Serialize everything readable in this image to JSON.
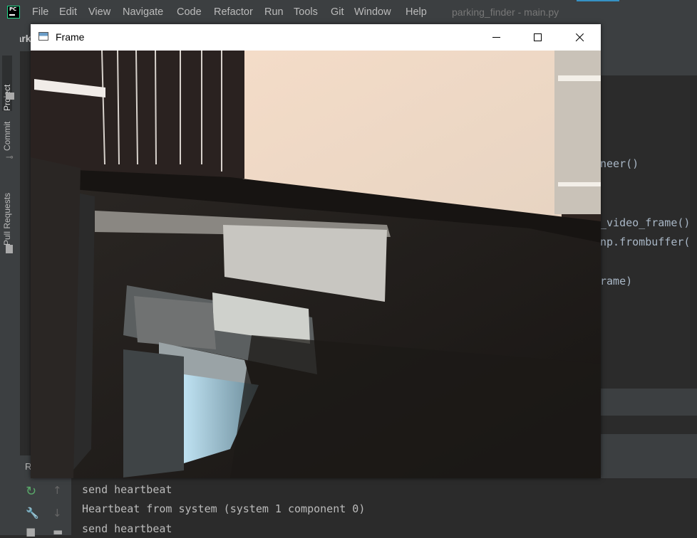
{
  "ide": {
    "menu": [
      "File",
      "Edit",
      "View",
      "Navigate",
      "Code",
      "Refactor",
      "Run",
      "Tools",
      "Git",
      "Window",
      "Help"
    ],
    "window_title": "parking_finder - main.py",
    "project_label": "park",
    "side_tabs": [
      "Project",
      "Commit",
      "Pull Requests"
    ],
    "code_fragments": [
      "neer()",
      "_video_frame()",
      "np.frombuffer(",
      "rame)"
    ],
    "run_panel_label": "R",
    "console_lines": [
      "send heartbeat",
      "Heartbeat from system (system 1 component 0)",
      "send heartbeat"
    ]
  },
  "frame_window": {
    "title": "Frame",
    "icons": {
      "app": "opencv-window-icon",
      "minimize": "minimize-icon",
      "maximize": "maximize-icon",
      "close": "close-icon"
    }
  },
  "colors": {
    "ide_bg": "#2b2b2b",
    "ide_panel": "#3c3f41",
    "accent": "#3592c4",
    "pycharm_green": "#21d789"
  }
}
